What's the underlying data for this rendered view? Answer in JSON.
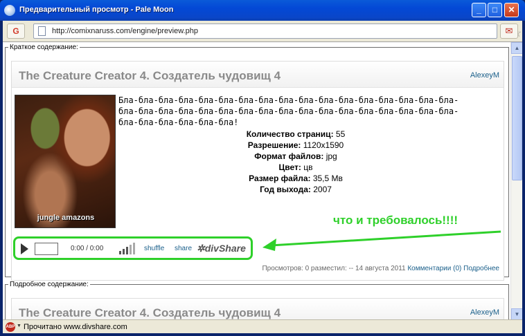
{
  "window": {
    "title": "Предварительный просмотр - Pale Moon",
    "buttons": {
      "minimize": "_",
      "maximize": "□",
      "close": "✕"
    }
  },
  "navbar": {
    "home_button": "G",
    "url": "http://comixnaruss.com/engine/preview.php"
  },
  "short_block": {
    "legend": "Краткое содержание:",
    "title": "The Creature Creator 4. Создатель чудовищ 4",
    "author": "AlexeyM",
    "cover_caption": "jungle amazons",
    "description": "Бла-бла-бла-бла-бла-бла-бла-бла-бла-бла-бла-бла-бла-бла-бла-бла-бла-бла-бла-бла-бла-бла-бла-бла-бла-бла-бла-бла-бла-бла-бла-бла-бла-бла-бла-бла-бла-бла-бла-бла!",
    "specs": [
      {
        "label": "Количество страниц:",
        "value": "55"
      },
      {
        "label": "Разрешение:",
        "value": "1120x1590"
      },
      {
        "label": "Формат файлов:",
        "value": "jpg"
      },
      {
        "label": "Цвет:",
        "value": "цв"
      },
      {
        "label": "Размер файла:",
        "value": "35,5 Мв"
      },
      {
        "label": "Год выхода:",
        "value": "2007"
      }
    ],
    "annotation": "что и требовалось!!!!",
    "player": {
      "time": "0:00 / 0:00",
      "shuffle": "shuffle",
      "share": "share",
      "brand": "✲divShare"
    },
    "meta": {
      "views": "Просмотров: 0 разместил: -- 14 августа 2011",
      "comments": "Комментарии (0)",
      "more": "Подробнее"
    }
  },
  "full_block": {
    "legend": "Подробное содержание:",
    "title": "The Creature Creator 4. Создатель чудовищ 4",
    "author": "AlexeyM"
  },
  "statusbar": {
    "abp": "ABP",
    "text": "Прочитано www.divshare.com"
  },
  "colors": {
    "highlight": "#2ed02a",
    "link": "#1a5f8a"
  }
}
